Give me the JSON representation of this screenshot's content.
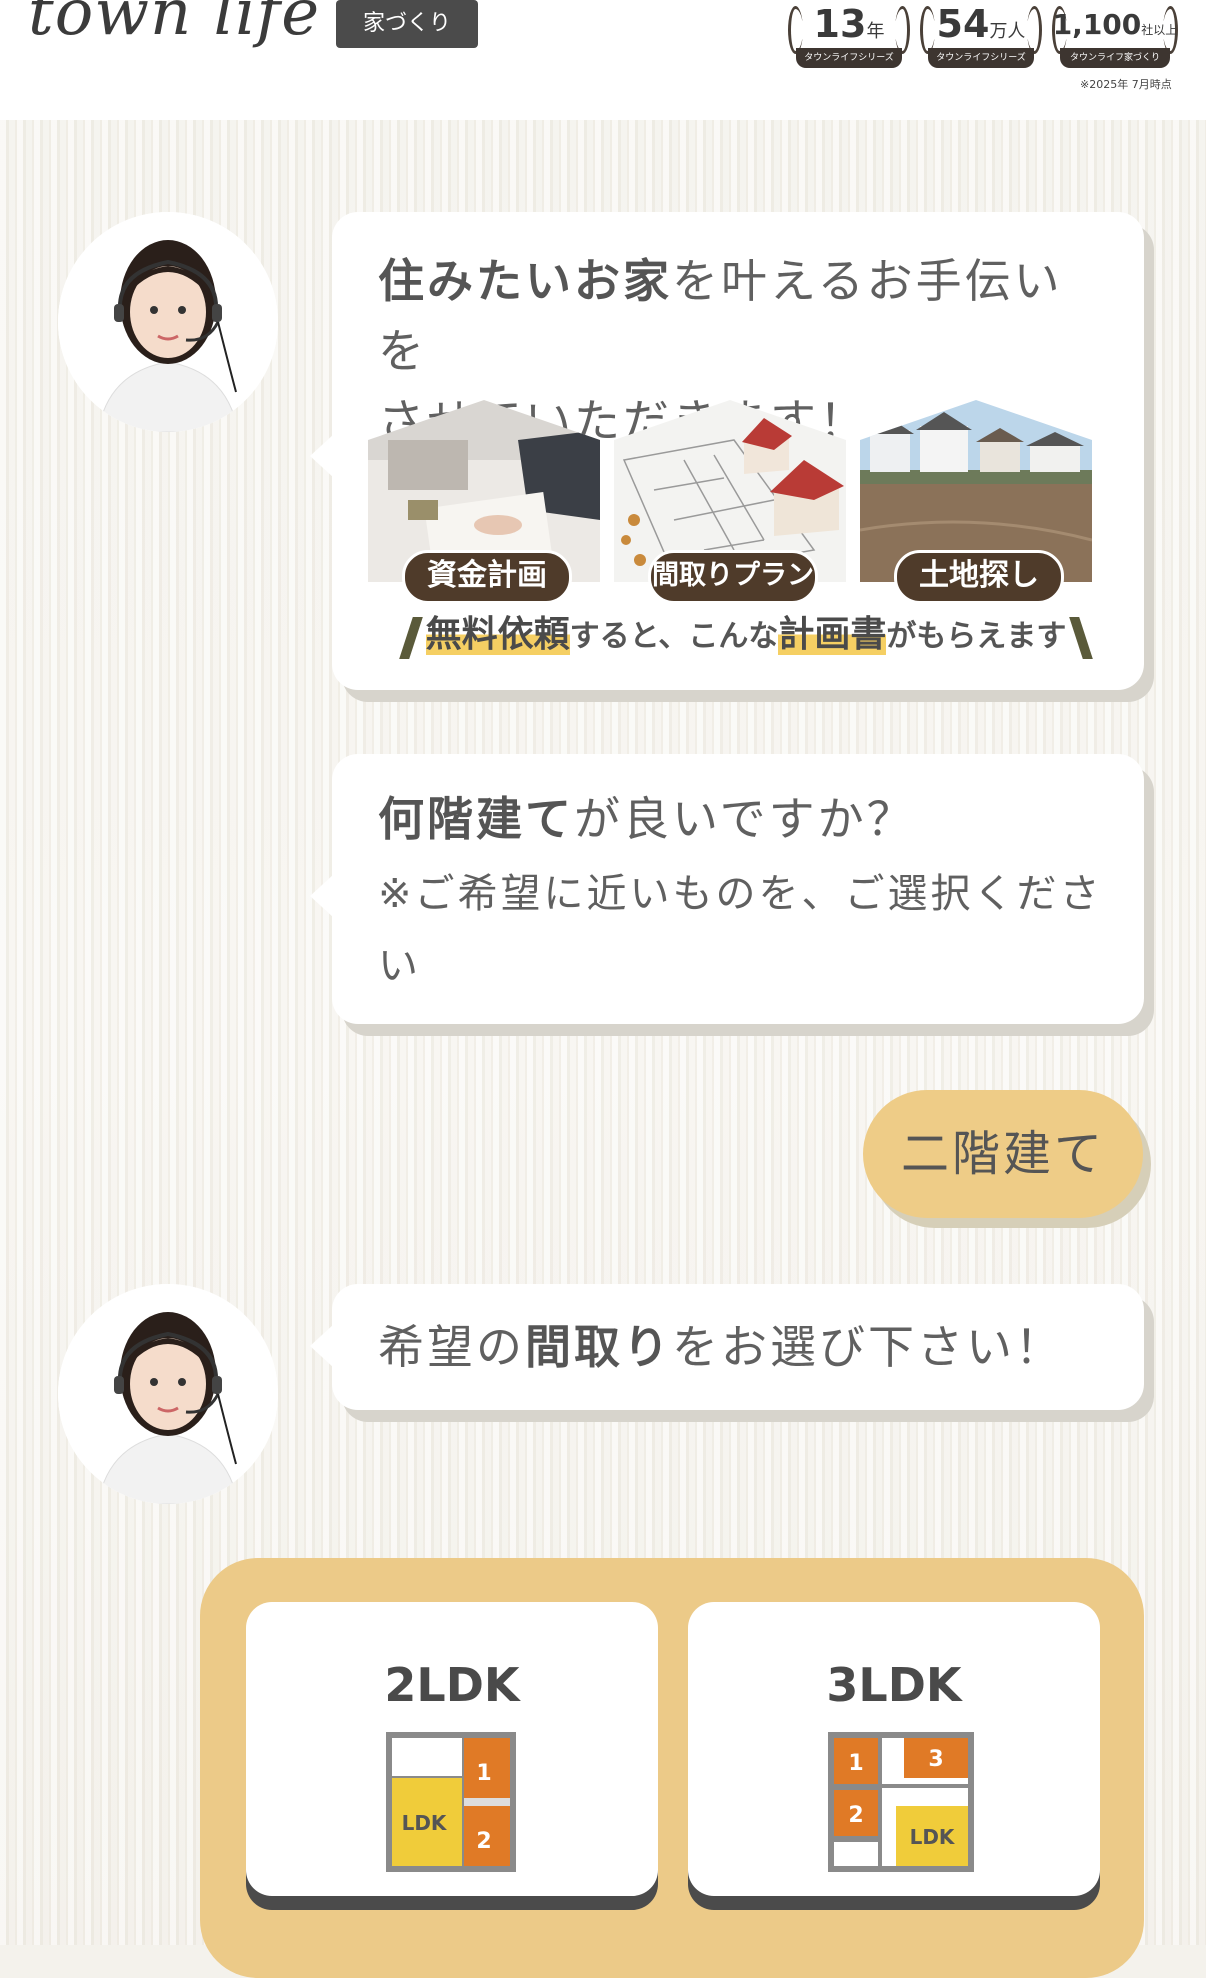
{
  "header": {
    "logo": "town life",
    "logo_tag": "家づくり",
    "badges": [
      {
        "number": "13",
        "unit": "年",
        "caption": "タウンライフシリーズ"
      },
      {
        "number": "54",
        "unit": "万人",
        "caption": "タウンライフシリーズ"
      },
      {
        "number": "1,100",
        "unit": "社以上",
        "caption": "タウンライフ家づくり"
      }
    ],
    "badge_note": "※2025年 7月時点"
  },
  "messages": {
    "intro": {
      "line1_bold": "住みたいお家",
      "line1_rest": "を叶えるお手伝いを",
      "line2": "させていただきます！",
      "cards": [
        {
          "label": "資金計画",
          "icon": "money-plan-photo"
        },
        {
          "label": "間取りプラン",
          "icon": "floor-plan-photo"
        },
        {
          "label": "土地探し",
          "icon": "land-photo"
        }
      ],
      "sub_hl1": "無料依頼",
      "sub_mid": "すると、こんな",
      "sub_hl2": "計画書",
      "sub_end": "がもらえます"
    },
    "question": {
      "bold": "何階建て",
      "rest": "が良いですか？",
      "note": "※ご希望に近いものを、ご選択ください"
    },
    "answer": "二階建て",
    "layout_prompt": {
      "pre": "希望の",
      "bold": "間取り",
      "post": "をお選び下さい！"
    }
  },
  "choices": [
    {
      "title": "2LDK",
      "icon": "floorplan-2ldk-icon"
    },
    {
      "title": "3LDK",
      "icon": "floorplan-3ldk-icon"
    }
  ],
  "colors": {
    "accent": "#ECCA88",
    "label_brown": "#4F3B2A",
    "highlight": "#F5CF63"
  }
}
